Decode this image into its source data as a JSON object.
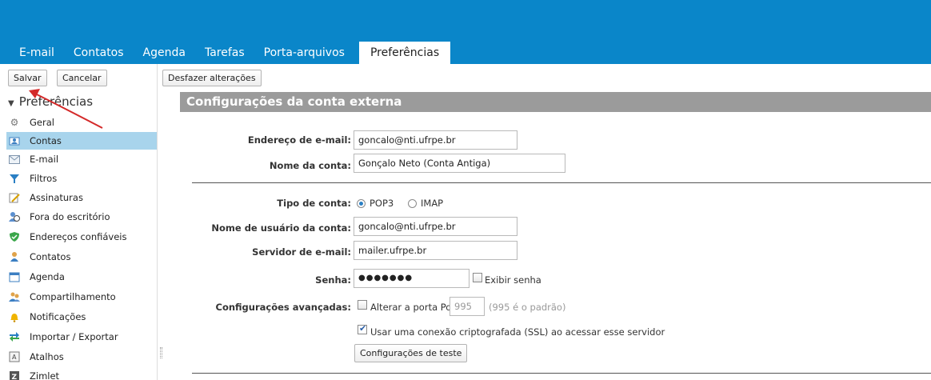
{
  "tabs": [
    {
      "label": "E-mail"
    },
    {
      "label": "Contatos"
    },
    {
      "label": "Agenda"
    },
    {
      "label": "Tarefas"
    },
    {
      "label": "Porta-arquivos"
    },
    {
      "label": "Preferências",
      "active": true
    }
  ],
  "toolbar": {
    "save_label": "Salvar",
    "cancel_label": "Cancelar",
    "undo_label": "Desfazer alterações"
  },
  "sidebar": {
    "header": "Preferências",
    "items": [
      {
        "label": "Geral",
        "icon": "gear-icon"
      },
      {
        "label": "Contas",
        "icon": "accounts-icon",
        "selected": true
      },
      {
        "label": "E-mail",
        "icon": "envelope-icon"
      },
      {
        "label": "Filtros",
        "icon": "filter-icon"
      },
      {
        "label": "Assinaturas",
        "icon": "signature-icon"
      },
      {
        "label": "Fora do escritório",
        "icon": "out-of-office-icon"
      },
      {
        "label": "Endereços confiáveis",
        "icon": "shield-check-icon"
      },
      {
        "label": "Contatos",
        "icon": "contact-icon"
      },
      {
        "label": "Agenda",
        "icon": "calendar-icon"
      },
      {
        "label": "Compartilhamento",
        "icon": "sharing-icon"
      },
      {
        "label": "Notificações",
        "icon": "bell-icon"
      },
      {
        "label": "Importar / Exportar",
        "icon": "import-export-icon"
      },
      {
        "label": "Atalhos",
        "icon": "keyboard-icon"
      },
      {
        "label": "Zimlet",
        "icon": "zimlet-icon"
      }
    ]
  },
  "content": {
    "section_title": "Configurações da conta externa",
    "email_label": "Endereço de e-mail:",
    "email_value": "goncalo@nti.ufrpe.br",
    "account_name_label": "Nome da conta:",
    "account_name_value": "Gonçalo Neto (Conta Antiga)",
    "account_type_label": "Tipo de conta:",
    "pop3_label": "POP3",
    "imap_label": "IMAP",
    "username_label": "Nome de usuário da conta:",
    "username_value": "goncalo@nti.ufrpe.br",
    "server_label": "Servidor de e-mail:",
    "server_value": "mailer.ufrpe.br",
    "password_label": "Senha:",
    "password_value": "●●●●●●●",
    "show_password_label": "Exibir senha",
    "advanced_label": "Configurações avançadas:",
    "change_port_label": "Alterar a porta Pop",
    "port_value": "995",
    "port_default_hint": "(995 é o padrão)",
    "ssl_label": "Usar uma conexão criptografada (SSL) ao acessar esse servidor",
    "test_button_label": "Configurações de teste"
  },
  "colors": {
    "header_blue": "#0a86c9",
    "selected_item": "#a8d4ec",
    "section_gray": "#9b9b9b",
    "annotation_arrow": "#d42a2a"
  }
}
